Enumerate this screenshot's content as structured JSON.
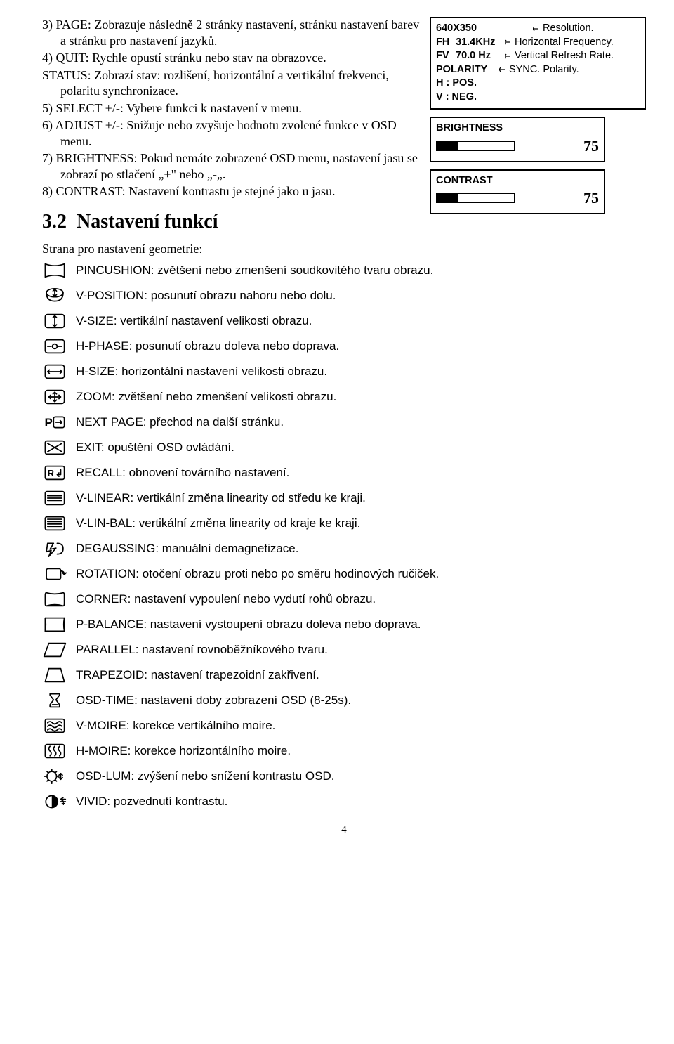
{
  "items": [
    {
      "n": "3)",
      "label": "PAGE:",
      "text": " Zobrazuje následně 2 stránky nastavení, stránku nastavení barev a stránku pro nastavení jazyků."
    },
    {
      "n": "4)",
      "label": "QUIT:",
      "text": " Rychle opustí stránku nebo stav na obrazovce."
    },
    {
      "n": "",
      "label": "STATUS:",
      "text": " Zobrazí stav: rozlišení, horizontální a vertikální frekvenci, polaritu synchronizace."
    },
    {
      "n": "5)",
      "label": "SELECT +/-:",
      "text": " Vybere funkci k nastavení v menu."
    },
    {
      "n": "6)",
      "label": "ADJUST +/-:",
      "text": " Snižuje nebo zvyšuje hodnotu zvolené funkce v OSD menu."
    },
    {
      "n": "7)",
      "label": "BRIGHTNESS:",
      "text": " Pokud nemáte zobrazené OSD menu, nastavení jasu se zobrazí po stlačení „+\" nebo „-„."
    },
    {
      "n": "8)",
      "label": "CONTRAST:",
      "text": " Nastavení kontrastu je stejné jako u jasu."
    }
  ],
  "section_number": "3.2",
  "section_title": "Nastavení funkcí",
  "sub_lead": "Strana pro nastavení geometrie:",
  "status_fig": {
    "res": "640X350",
    "res_lbl": "Resolution.",
    "fh_l": "FH",
    "fh_v": "31.4KHz",
    "fh_lbl": "Horizontal Frequency.",
    "fv_l": "FV",
    "fv_v": "70.0  Hz",
    "fv_lbl": "Vertical Refresh Rate.",
    "pol": "POLARITY",
    "pol_lbl": "SYNC. Polarity.",
    "h": "H  : POS.",
    "v": "V  : NEG."
  },
  "bars": [
    {
      "label": "BRIGHTNESS",
      "val": "75",
      "pct": 28
    },
    {
      "label": "CONTRAST",
      "val": "75",
      "pct": 28
    }
  ],
  "functions": [
    {
      "icon": "pincushion-icon",
      "text": "PINCUSHION: zvětšení nebo zmenšení soudkovitého tvaru obrazu."
    },
    {
      "icon": "v-position-icon",
      "text": "V-POSITION: posunutí obrazu nahoru nebo dolu."
    },
    {
      "icon": "v-size-icon",
      "text": "V-SIZE: vertikální nastavení velikosti obrazu."
    },
    {
      "icon": "h-phase-icon",
      "text": "H-PHASE: posunutí obrazu doleva nebo doprava."
    },
    {
      "icon": "h-size-icon",
      "text": "H-SIZE: horizontální nastavení velikosti obrazu."
    },
    {
      "icon": "zoom-icon",
      "text": "ZOOM: zvětšení nebo zmenšení velikosti obrazu."
    },
    {
      "icon": "next-page-icon",
      "text": "NEXT PAGE: přechod na další stránku."
    },
    {
      "icon": "exit-icon",
      "text": "EXIT: opuštění OSD ovládání."
    },
    {
      "icon": "recall-icon",
      "text": "RECALL: obnovení továrního nastavení."
    },
    {
      "icon": "v-linear-icon",
      "text": "V-LINEAR: vertikální změna linearity od středu ke kraji."
    },
    {
      "icon": "v-lin-bal-icon",
      "text": "V-LIN-BAL: vertikální změna linearity od kraje ke kraji."
    },
    {
      "icon": "degaussing-icon",
      "text": "DEGAUSSING: manuální demagnetizace."
    },
    {
      "icon": "rotation-icon",
      "text": "ROTATION: otočení obrazu proti nebo po směru hodinových ručiček."
    },
    {
      "icon": "corner-icon",
      "text": "CORNER: nastavení vypoulení nebo vydutí rohů obrazu."
    },
    {
      "icon": "p-balance-icon",
      "text": "P-BALANCE: nastavení vystoupení obrazu doleva nebo doprava."
    },
    {
      "icon": "parallel-icon",
      "text": "PARALLEL: nastavení rovnoběžníkového tvaru."
    },
    {
      "icon": "trapezoid-icon",
      "text": "TRAPEZOID: nastavení trapezoidní zakřivení."
    },
    {
      "icon": "osd-time-icon",
      "text": "OSD-TIME: nastavení doby zobrazení OSD (8-25s)."
    },
    {
      "icon": "v-moire-icon",
      "text": "V-MOIRE: korekce vertikálního moire."
    },
    {
      "icon": "h-moire-icon",
      "text": "H-MOIRE: korekce horizontálního moire."
    },
    {
      "icon": "osd-lum-icon",
      "text": "OSD-LUM: zvýšení nebo snížení kontrastu OSD."
    },
    {
      "icon": "vivid-icon",
      "text": "VIVID: pozvednutí kontrastu."
    }
  ],
  "page_number": "4"
}
